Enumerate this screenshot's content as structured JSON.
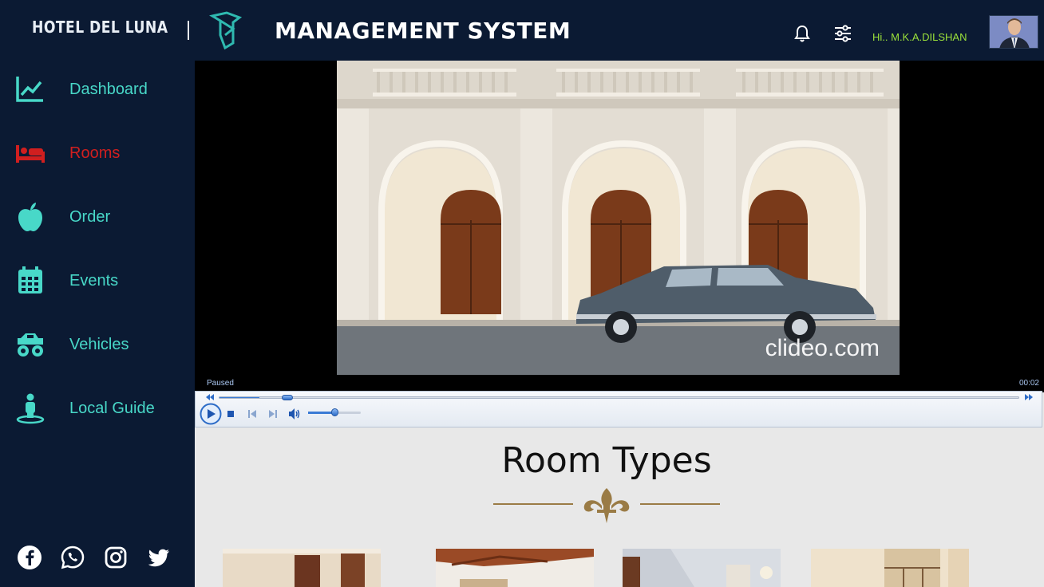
{
  "header": {
    "brand": "HOTEL DEL LUNA",
    "title": "MANAGEMENT SYSTEM",
    "greeting": "Hi.. M.K.A.DILSHAN",
    "icons": [
      "bell-icon",
      "sliders-icon"
    ]
  },
  "sidebar": {
    "items": [
      {
        "label": "Dashboard",
        "icon": "chart-line-icon",
        "active": false
      },
      {
        "label": "Rooms",
        "icon": "bed-icon",
        "active": true
      },
      {
        "label": "Order",
        "icon": "apple-icon",
        "active": false
      },
      {
        "label": "Events",
        "icon": "calendar-icon",
        "active": false
      },
      {
        "label": "Vehicles",
        "icon": "monster-truck-icon",
        "active": false
      },
      {
        "label": "Local Guide",
        "icon": "street-view-icon",
        "active": false
      }
    ],
    "socials": [
      "facebook-icon",
      "whatsapp-icon",
      "instagram-icon",
      "twitter-icon"
    ]
  },
  "player": {
    "status": "Paused",
    "time": "00:02",
    "watermark": "clideo.com",
    "progress": 0.05,
    "volume": 0.5
  },
  "main": {
    "section_title": "Room Types"
  },
  "colors": {
    "background": "#0b1a33",
    "accent": "#48d8c8",
    "active": "#d01f1f",
    "greeting": "#9be13a",
    "ornament": "#9a7b45"
  }
}
